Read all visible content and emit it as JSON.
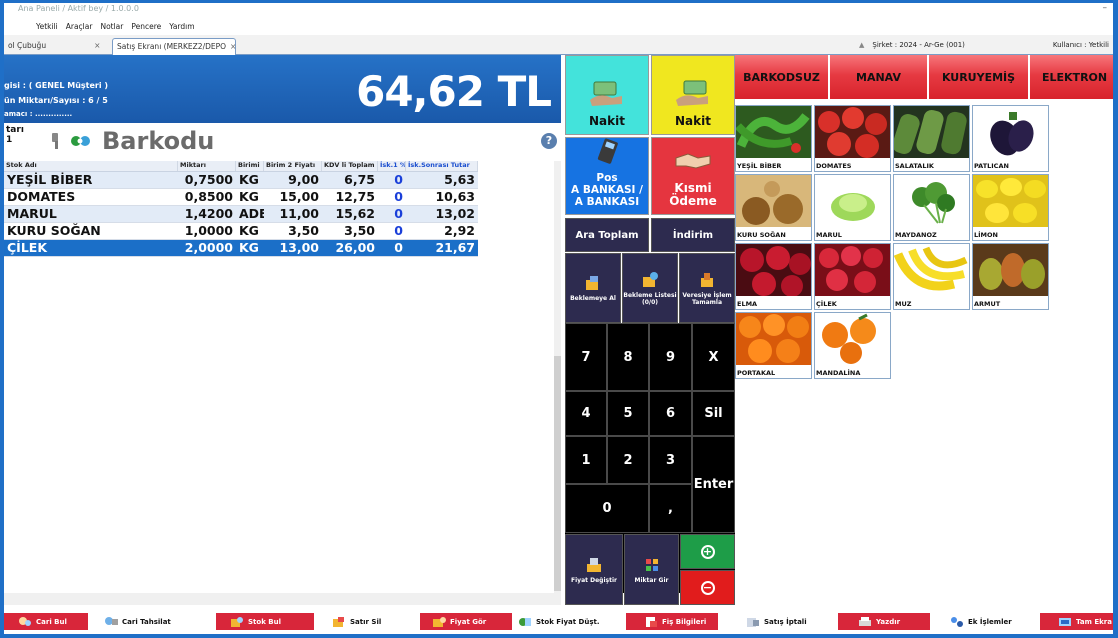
{
  "window": {
    "title": "Ana Paneli / Aktif bey / 1.0.0.0"
  },
  "menu": [
    "Yetkili",
    "Araçlar",
    "Notlar",
    "Pencere",
    "Yardım"
  ],
  "tabs": [
    {
      "label": "ol Çubuğu",
      "close": "×"
    },
    {
      "label": "Satış Ekranı (MERKEZ2/DEPO",
      "close": "×"
    }
  ],
  "status": {
    "company": "Şirket : 2024 - Ar-Ge (001)",
    "user": "Kullanıcı : Yetkili"
  },
  "sale": {
    "customer": "gisi : ( GENEL Müşteri )",
    "quantity": "ün Miktarı/Sayısı : 6 / 5",
    "rep": "amacı : ..............",
    "total": "64,62 TL",
    "cari_label": "tarı",
    "barcode_title": "Barkodu",
    "help": "?"
  },
  "table": {
    "headers": [
      "Stok Adı",
      "Miktarı",
      "Birimi",
      "Birim 2 Fiyatı",
      "KDV li Toplam",
      "İsk.1 %",
      "İsk.Sonrası Tutar"
    ],
    "rows": [
      {
        "name": "YEŞİL BİBER",
        "qty": "0,7500",
        "unit": "KG",
        "price": "9,00",
        "kdv": "6,75",
        "disc": "0",
        "net": "5,63"
      },
      {
        "name": "DOMATES",
        "qty": "0,8500",
        "unit": "KG",
        "price": "15,00",
        "kdv": "12,75",
        "disc": "0",
        "net": "10,63"
      },
      {
        "name": "MARUL",
        "qty": "1,4200",
        "unit": "ADET",
        "price": "11,00",
        "kdv": "15,62",
        "disc": "0",
        "net": "13,02"
      },
      {
        "name": "KURU SOĞAN",
        "qty": "1,0000",
        "unit": "KG",
        "price": "3,50",
        "kdv": "3,50",
        "disc": "0",
        "net": "2,92"
      },
      {
        "name": "ÇİLEK",
        "qty": "2,0000",
        "unit": "KG",
        "price": "13,00",
        "kdv": "26,00",
        "disc": "0",
        "net": "21,67"
      }
    ]
  },
  "pay": {
    "nakit1": "Nakit",
    "nakit2": "Nakit",
    "pos_line1": "Pos",
    "pos_line2": "A BANKASI /",
    "pos_line3": "A BANKASI",
    "kismi_line1": "Kısmi",
    "kismi_line2": "Ödeme",
    "ara_toplam": "Ara Toplam",
    "indirim": "İndirim",
    "bekle": "Beklemeye Al",
    "bekleme_listesi": "Bekleme Listesi",
    "bekleme_count": "(0/0)",
    "veresiye_1": "Veresiye İşlem",
    "veresiye_2": "Tamamla",
    "fiyat_degistir": "Fiyat Değiştir",
    "miktar_gir": "Miktar Gir",
    "plus": "+",
    "minus": "−"
  },
  "numpad": {
    "k7": "7",
    "k8": "8",
    "k9": "9",
    "kx": "X",
    "k4": "4",
    "k5": "5",
    "k6": "6",
    "ksil": "Sil",
    "k1": "1",
    "k2": "2",
    "k3": "3",
    "kenter": "Enter",
    "k0": "0",
    "kcomma": ","
  },
  "categories": [
    "BARKODSUZ",
    "MANAV",
    "KURUYEMİŞ",
    "ELEKTRON"
  ],
  "products": [
    {
      "label": "YEŞİL BİBER",
      "icon": "green-pepper-icon"
    },
    {
      "label": "DOMATES",
      "icon": "tomato-icon"
    },
    {
      "label": "SALATALIK",
      "icon": "cucumber-icon"
    },
    {
      "label": "PATLICAN",
      "icon": "eggplant-icon"
    },
    {
      "label": "KURU SOĞAN",
      "icon": "onion-icon"
    },
    {
      "label": "MARUL",
      "icon": "lettuce-icon"
    },
    {
      "label": "MAYDANOZ",
      "icon": "parsley-icon"
    },
    {
      "label": "LİMON",
      "icon": "lemon-icon"
    },
    {
      "label": "ELMA",
      "icon": "apple-icon"
    },
    {
      "label": "ÇİLEK",
      "icon": "strawberry-icon"
    },
    {
      "label": "MUZ",
      "icon": "banana-icon"
    },
    {
      "label": "ARMUT",
      "icon": "pear-icon"
    },
    {
      "label": "PORTAKAL",
      "icon": "orange-icon"
    },
    {
      "label": "MANDALİNA",
      "icon": "mandarin-icon"
    }
  ],
  "bottombar": [
    "Cari Bul",
    "Cari Tahsilat",
    "Stok Bul",
    "Satır Sil",
    "Fiyat Gör",
    "Stok Fiyat Düşt.",
    "Fiş Bilgileri",
    "Satış İptali",
    "Yazdır",
    "Ek İşlemler",
    "Tam Ekra"
  ],
  "colors": {
    "accent": "#1f6fc7",
    "panel_blue": "#1d62b7",
    "nakit_cyan": "#43e3db",
    "nakit_yellow": "#f0e71f",
    "pos_blue": "#1673e2",
    "kismi_red": "#e5353f",
    "category_red": "#e63a42",
    "dark_button": "#2d2b4f"
  }
}
